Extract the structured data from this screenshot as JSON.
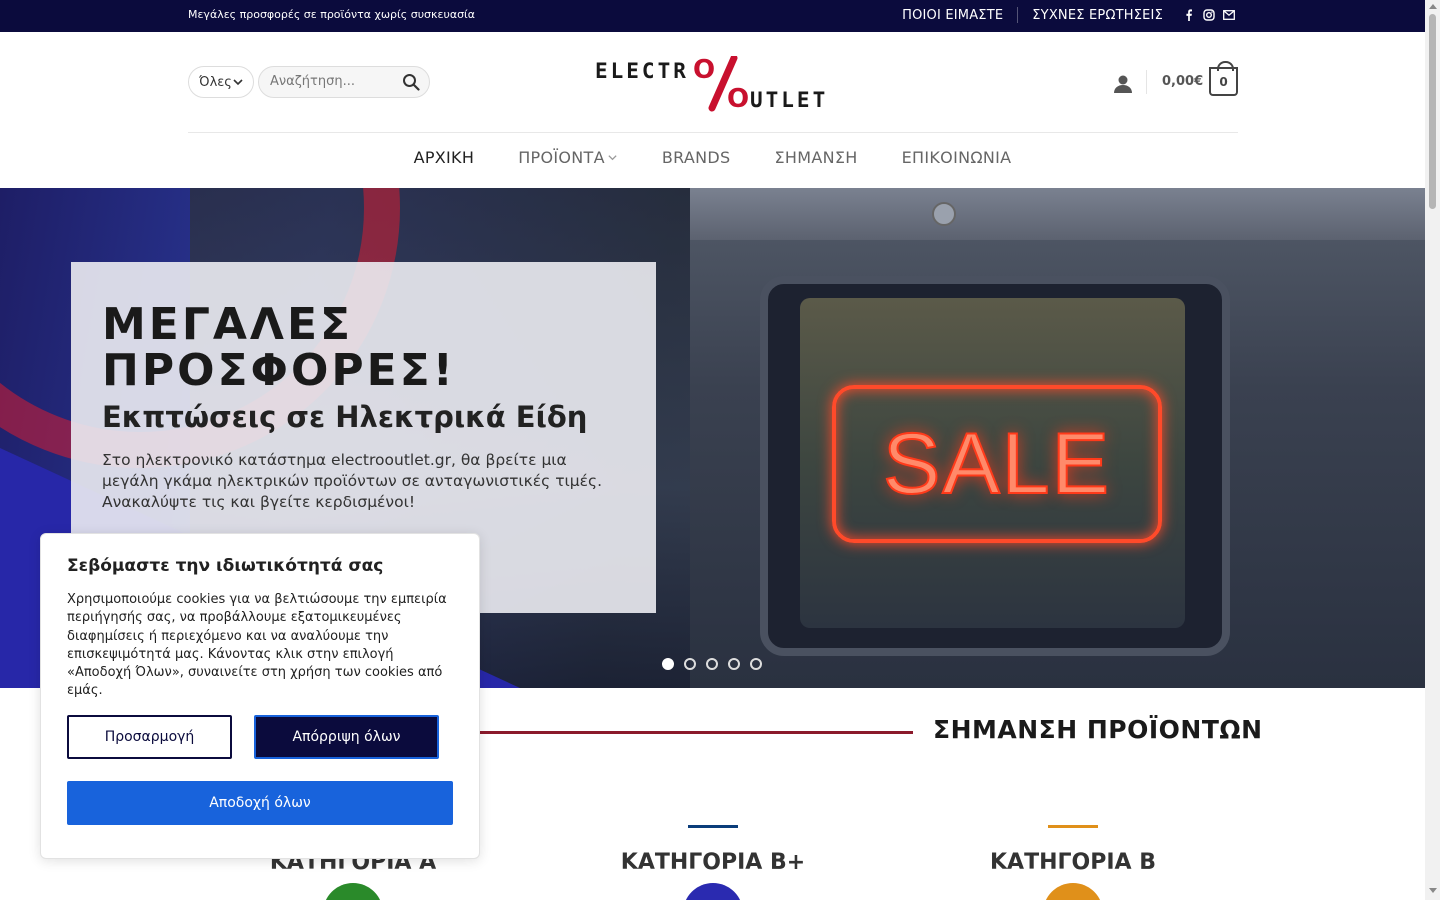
{
  "topbar": {
    "promo": "Μεγάλες προσφορές σε προϊόντα χωρίς συσκευασία",
    "links": [
      "ΠΟΙΟΙ ΕΙΜΑΣΤΕ",
      "ΣΥΧΝΕΣ ΕΡΩΤΗΣΕΙΣ"
    ],
    "social_icons": [
      "facebook-icon",
      "instagram-icon",
      "email-icon"
    ]
  },
  "header": {
    "category_select": "Όλες",
    "search_placeholder": "Αναζήτηση...",
    "logo": {
      "line1": "ELECTRO",
      "line2": "OUTLET",
      "symbol": "%"
    },
    "cart_total": "0,00€",
    "cart_count": "0"
  },
  "nav": {
    "items": [
      {
        "label": "ΑΡΧΙΚΗ",
        "active": true
      },
      {
        "label": "ΠΡΟΪΟΝΤΑ",
        "dropdown": true
      },
      {
        "label": "BRANDS"
      },
      {
        "label": "ΣΗΜΑΝΣΗ"
      },
      {
        "label": "ΕΠΙΚΟΙΝΩΝΙΑ"
      }
    ]
  },
  "hero": {
    "title": "ΜΕΓΑΛΕΣ ΠΡΟΣΦΟΡΕΣ!",
    "subtitle": "Εκπτώσεις σε Ηλεκτρικά Είδη",
    "description": "Στο ηλεκτρονικό κατάστημα electrooutlet.gr, θα βρείτε μια μεγάλη γκάμα ηλεκτρικών προϊόντων σε ανταγωνιστικές τιμές. Ανακαλύψτε τις και βγείτε κερδισμένοι!",
    "sign_text": "SALE",
    "slides": 5,
    "active_slide": 1
  },
  "energy": {
    "title": "ΣΗΜΑΝΣΗ ΠΡΟΪΟΝΤΩΝ",
    "categories": [
      {
        "label": "ΚΑΤΗΓΟΡΙΑ Α",
        "color": "#2a8a2a"
      },
      {
        "label": "ΚΑΤΗΓΟΡΙΑ Β+",
        "color": "#0b3d7a"
      },
      {
        "label": "ΚΑΤΗΓΟΡΙΑ Β",
        "color": "#e0901a"
      }
    ]
  },
  "cookie": {
    "title": "Σεβόμαστε την ιδιωτικότητά σας",
    "text": "Χρησιμοποιούμε cookies για να βελτιώσουμε την εμπειρία περιήγησής σας, να προβάλλουμε εξατομικευμένες διαφημίσεις ή περιεχόμενο και να αναλύουμε την επισκεψιμότητά μας. Κάνοντας κλικ στην επιλογή «Αποδοχή Όλων», συναινείτε στη χρήση των cookies από εμάς.",
    "customize": "Προσαρμογή",
    "reject": "Απόρριψη όλων",
    "accept": "Αποδοχή όλων"
  },
  "colors": {
    "topbar_bg": "#0b0b3d",
    "accent_blue": "#1863dc",
    "logo_red": "#c8102e",
    "section_line": "#8b1a2b"
  }
}
